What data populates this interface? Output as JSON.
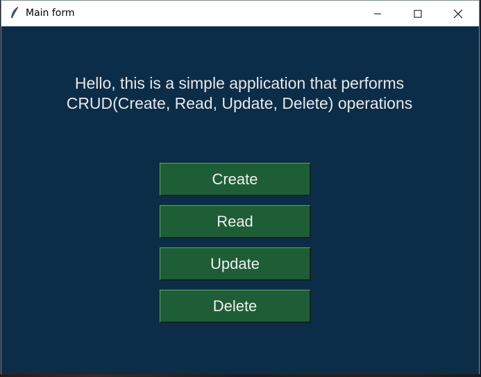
{
  "window": {
    "title": "Main form",
    "controls": {
      "minimize": "minimize-icon",
      "maximize": "maximize-icon",
      "close": "close-icon"
    }
  },
  "main": {
    "intro_line1": "Hello, this is a simple application that performs",
    "intro_line2": "CRUD(Create, Read, Update, Delete) operations",
    "buttons": {
      "create": "Create",
      "read": "Read",
      "update": "Update",
      "delete": "Delete"
    }
  },
  "colors": {
    "background": "#0c2d48",
    "button": "#1e5e36",
    "text": "#e8e8e8"
  }
}
